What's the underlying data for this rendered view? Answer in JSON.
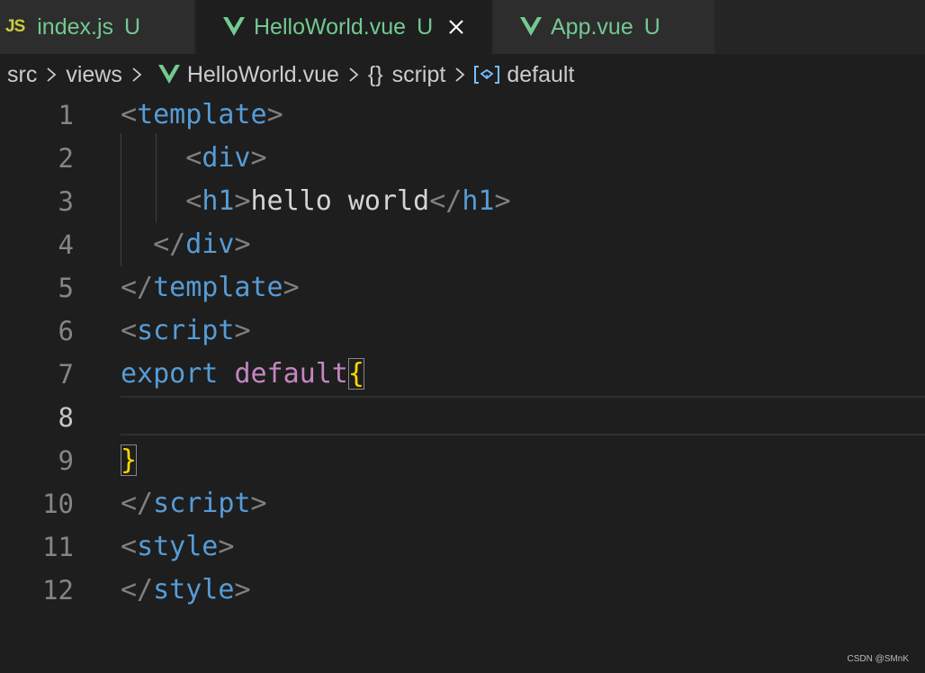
{
  "tabs": [
    {
      "icon": "JS",
      "name": "index.js",
      "status": "U"
    },
    {
      "name": "HelloWorld.vue",
      "status": "U"
    },
    {
      "name": "App.vue",
      "status": "U"
    }
  ],
  "breadcrumb": {
    "src": "src",
    "views": "views",
    "file": "HelloWorld.vue",
    "brace": "{}",
    "script": "script",
    "symbol": "default"
  },
  "editor": {
    "current_line": 8,
    "lines": [
      {
        "num": "1"
      },
      {
        "num": "2"
      },
      {
        "num": "3"
      },
      {
        "num": "4"
      },
      {
        "num": "5"
      },
      {
        "num": "6"
      },
      {
        "num": "7"
      },
      {
        "num": "8"
      },
      {
        "num": "9"
      },
      {
        "num": "10"
      },
      {
        "num": "11"
      },
      {
        "num": "12"
      }
    ],
    "tokens": {
      "l1_open": "<",
      "l1_tag": "template",
      "l1_close": ">",
      "l2_indent": "    ",
      "l2_open": "<",
      "l2_tag": "div",
      "l2_close": ">",
      "l3_indent": "    ",
      "l3_open": "<",
      "l3_tag": "h1",
      "l3_close": ">",
      "l3_text": "hello world",
      "l3_open2": "</",
      "l3_tag2": "h1",
      "l3_close2": ">",
      "l4_indent": "  ",
      "l4_open": "</",
      "l4_tag": "div",
      "l4_close": ">",
      "l5_open": "</",
      "l5_tag": "template",
      "l5_close": ">",
      "l6_open": "<",
      "l6_tag": "script",
      "l6_close": ">",
      "l7_kw1": "export",
      "l7_sp": " ",
      "l7_kw2": "default",
      "l7_brace": "{",
      "l9_brace": "}",
      "l10_open": "</",
      "l10_tag": "script",
      "l10_close": ">",
      "l11_open": "<",
      "l11_tag": "style",
      "l11_close": ">",
      "l12_open": "</",
      "l12_tag": "style",
      "l12_close": ">"
    }
  },
  "watermark": "CSDN @SMnK",
  "colors": {
    "background": "#1e1e1e",
    "tag": "#569cd6",
    "keyword_default": "#c586c0",
    "brace": "#ffd700",
    "untracked": "#73c991"
  }
}
